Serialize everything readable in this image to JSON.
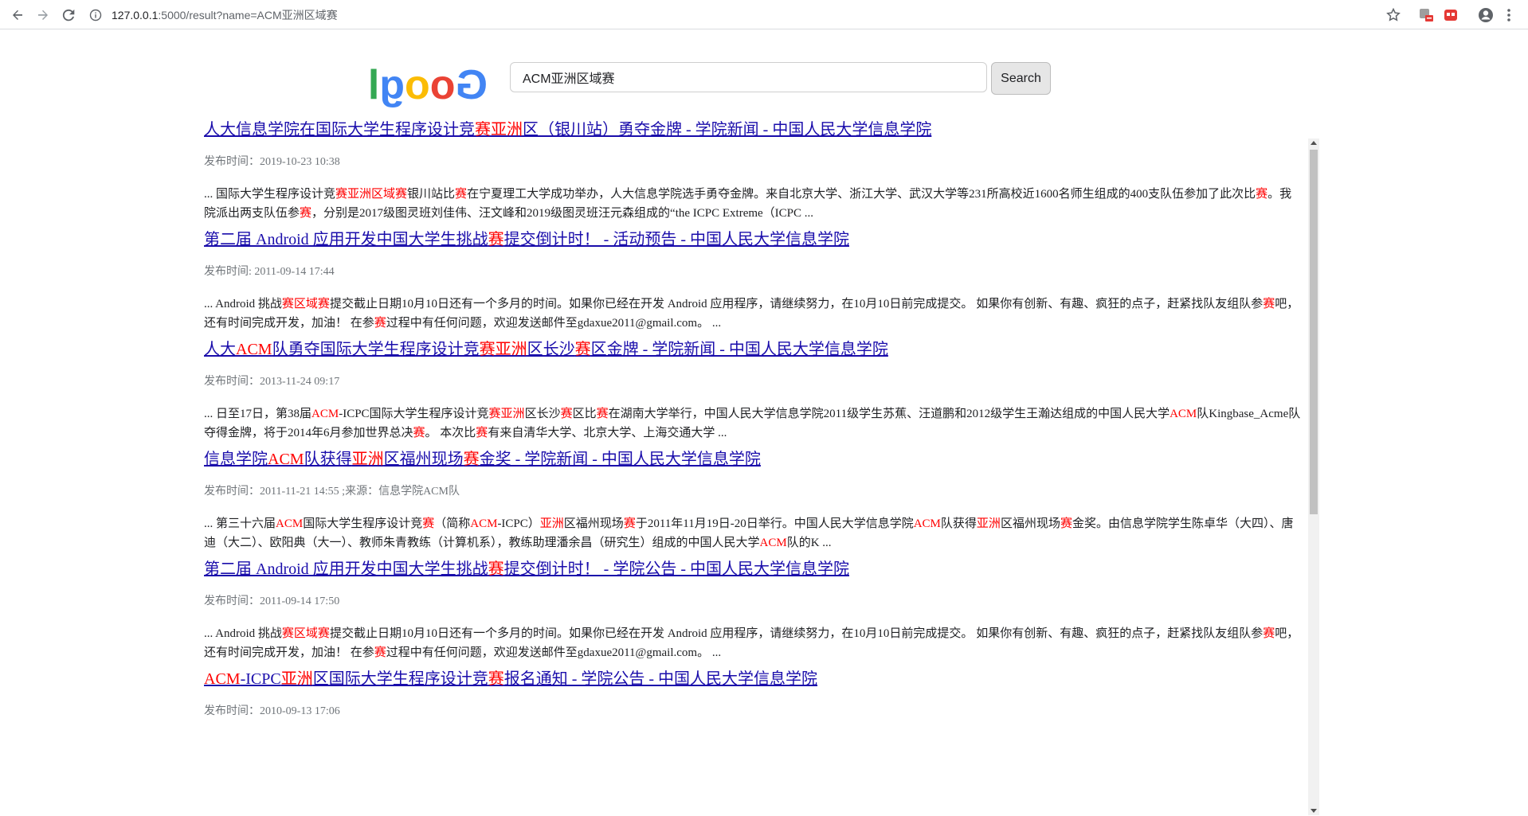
{
  "browser": {
    "url_host": "127.0.0.1",
    "url_rest": ":5000/result?name=ACM亚洲区域赛",
    "icons": [
      "back-arrow-icon",
      "forward-arrow-icon",
      "reload-icon",
      "info-icon",
      "star-icon",
      "extension-icon",
      "extension-red-icon",
      "account-icon",
      "menu-dots-icon"
    ]
  },
  "search": {
    "query": "ACM亚洲区域赛",
    "button_label": "Search",
    "logo_text": "Google"
  },
  "colors": {
    "link": "#1a0dab",
    "highlight": "#ff0000",
    "date": "#70757a"
  },
  "results": [
    {
      "title": [
        {
          "t": "人大信息学院在国际大学生程序设计竞",
          "hl": false
        },
        {
          "t": "赛亚洲",
          "hl": true
        },
        {
          "t": "区（银川站）勇夺金牌 - 学院新闻 - 中国人民大学信息学院",
          "hl": false
        }
      ],
      "date": "发布时间：2019-10-23 10:38",
      "snippet": [
        {
          "t": "... 国际大学生程序设计竞",
          "hl": false
        },
        {
          "t": "赛亚洲区域赛",
          "hl": true
        },
        {
          "t": "银川站比",
          "hl": false
        },
        {
          "t": "赛",
          "hl": true
        },
        {
          "t": "在宁夏理工大学成功举办，人大信息学院选手勇夺金牌。来自北京大学、浙江大学、武汉大学等231所高校近1600名师生组成的400支队伍参加了此次比",
          "hl": false
        },
        {
          "t": "赛",
          "hl": true
        },
        {
          "t": "。我院派出两支队伍参",
          "hl": false
        },
        {
          "t": "赛",
          "hl": true
        },
        {
          "t": "，分别是2017级图灵班刘佳伟、汪文峰和2019级图灵班汪元森组成的“the ICPC Extreme（ICPC ...",
          "hl": false
        }
      ]
    },
    {
      "title": [
        {
          "t": "第二届 Android 应用开发中国大学生挑战",
          "hl": false
        },
        {
          "t": "赛",
          "hl": true
        },
        {
          "t": "提交倒计时！ - 活动预告 - 中国人民大学信息学院",
          "hl": false
        }
      ],
      "date": "发布时间: 2011-09-14 17:44",
      "snippet": [
        {
          "t": "... Android 挑战",
          "hl": false
        },
        {
          "t": "赛区域赛",
          "hl": true
        },
        {
          "t": "提交截止日期10月10日还有一个多月的时间。如果你已经在开发 Android 应用程序，请继续努力，在10月10日前完成提交。 如果你有创新、有趣、疯狂的点子，赶紧找队友组队参",
          "hl": false
        },
        {
          "t": "赛",
          "hl": true
        },
        {
          "t": "吧，还有时间完成开发，加油！ 在参",
          "hl": false
        },
        {
          "t": "赛",
          "hl": true
        },
        {
          "t": "过程中有任何问题，欢迎发送邮件至gdaxue2011@gmail.com。 ...",
          "hl": false
        }
      ]
    },
    {
      "title": [
        {
          "t": "人大",
          "hl": false
        },
        {
          "t": "ACM",
          "hl": true
        },
        {
          "t": "队勇夺国际大学生程序设计竞",
          "hl": false
        },
        {
          "t": "赛亚洲",
          "hl": true
        },
        {
          "t": "区长沙",
          "hl": false
        },
        {
          "t": "赛",
          "hl": true
        },
        {
          "t": "区金牌 - 学院新闻 - 中国人民大学信息学院",
          "hl": false
        }
      ],
      "date": "发布时间：2013-11-24 09:17",
      "snippet": [
        {
          "t": "... 日至17日，第38届",
          "hl": false
        },
        {
          "t": "ACM",
          "hl": true
        },
        {
          "t": "-ICPC国际大学生程序设计竞",
          "hl": false
        },
        {
          "t": "赛亚洲",
          "hl": true
        },
        {
          "t": "区长沙",
          "hl": false
        },
        {
          "t": "赛",
          "hl": true
        },
        {
          "t": "区比",
          "hl": false
        },
        {
          "t": "赛",
          "hl": true
        },
        {
          "t": "在湖南大学举行，中国人民大学信息学院2011级学生苏蕉、汪道鹏和2012级学生王瀚达组成的中国人民大学",
          "hl": false
        },
        {
          "t": "ACM",
          "hl": true
        },
        {
          "t": "队Kingbase_Acme队夺得金牌，将于2014年6月参加世界总决",
          "hl": false
        },
        {
          "t": "赛",
          "hl": true
        },
        {
          "t": "。 本次比",
          "hl": false
        },
        {
          "t": "赛",
          "hl": true
        },
        {
          "t": "有来自清华大学、北京大学、上海交通大学 ...",
          "hl": false
        }
      ]
    },
    {
      "title": [
        {
          "t": "信息学院",
          "hl": false
        },
        {
          "t": "ACM",
          "hl": true
        },
        {
          "t": "队获得",
          "hl": false
        },
        {
          "t": "亚洲",
          "hl": true
        },
        {
          "t": "区福州现场",
          "hl": false
        },
        {
          "t": "赛",
          "hl": true
        },
        {
          "t": "金奖 - 学院新闻 - 中国人民大学信息学院",
          "hl": false
        }
      ],
      "date": "发布时间：2011-11-21 14:55 ;来源：信息学院ACM队",
      "snippet": [
        {
          "t": "... 第三十六届",
          "hl": false
        },
        {
          "t": "ACM",
          "hl": true
        },
        {
          "t": "国际大学生程序设计竞",
          "hl": false
        },
        {
          "t": "赛",
          "hl": true
        },
        {
          "t": "（简称",
          "hl": false
        },
        {
          "t": "ACM",
          "hl": true
        },
        {
          "t": "-ICPC）",
          "hl": false
        },
        {
          "t": "亚洲",
          "hl": true
        },
        {
          "t": "区福州现场",
          "hl": false
        },
        {
          "t": "赛",
          "hl": true
        },
        {
          "t": "于2011年11月19日-20日举行。中国人民大学信息学院",
          "hl": false
        },
        {
          "t": "ACM",
          "hl": true
        },
        {
          "t": "队获得",
          "hl": false
        },
        {
          "t": "亚洲",
          "hl": true
        },
        {
          "t": "区福州现场",
          "hl": false
        },
        {
          "t": "赛",
          "hl": true
        },
        {
          "t": "金奖。由信息学院学生陈卓华（大四）、唐迪（大二）、欧阳典（大一）、教师朱青教练（计算机系），教练助理潘余昌（研究生）组成的中国人民大学",
          "hl": false
        },
        {
          "t": "ACM",
          "hl": true
        },
        {
          "t": "队的K ...",
          "hl": false
        }
      ]
    },
    {
      "title": [
        {
          "t": "第二届 Android 应用开发中国大学生挑战",
          "hl": false
        },
        {
          "t": "赛",
          "hl": true
        },
        {
          "t": "提交倒计时！ - 学院公告 - 中国人民大学信息学院",
          "hl": false
        }
      ],
      "date": "发布时间：2011-09-14 17:50",
      "snippet": [
        {
          "t": "... Android 挑战",
          "hl": false
        },
        {
          "t": "赛区域赛",
          "hl": true
        },
        {
          "t": "提交截止日期10月10日还有一个多月的时间。如果你已经在开发 Android 应用程序，请继续努力，在10月10日前完成提交。 如果你有创新、有趣、疯狂的点子，赶紧找队友组队参",
          "hl": false
        },
        {
          "t": "赛",
          "hl": true
        },
        {
          "t": "吧，还有时间完成开发，加油！ 在参",
          "hl": false
        },
        {
          "t": "赛",
          "hl": true
        },
        {
          "t": "过程中有任何问题，欢迎发送邮件至gdaxue2011@gmail.com。 ...",
          "hl": false
        }
      ]
    },
    {
      "title": [
        {
          "t": "ACM",
          "hl": true
        },
        {
          "t": "-ICPC",
          "hl": false
        },
        {
          "t": "亚洲",
          "hl": true
        },
        {
          "t": "区国际大学生程序设计竞",
          "hl": false
        },
        {
          "t": "赛",
          "hl": true
        },
        {
          "t": "报名通知 - 学院公告 - 中国人民大学信息学院",
          "hl": false
        }
      ],
      "date": "发布时间：2010-09-13 17:06",
      "snippet": []
    }
  ]
}
